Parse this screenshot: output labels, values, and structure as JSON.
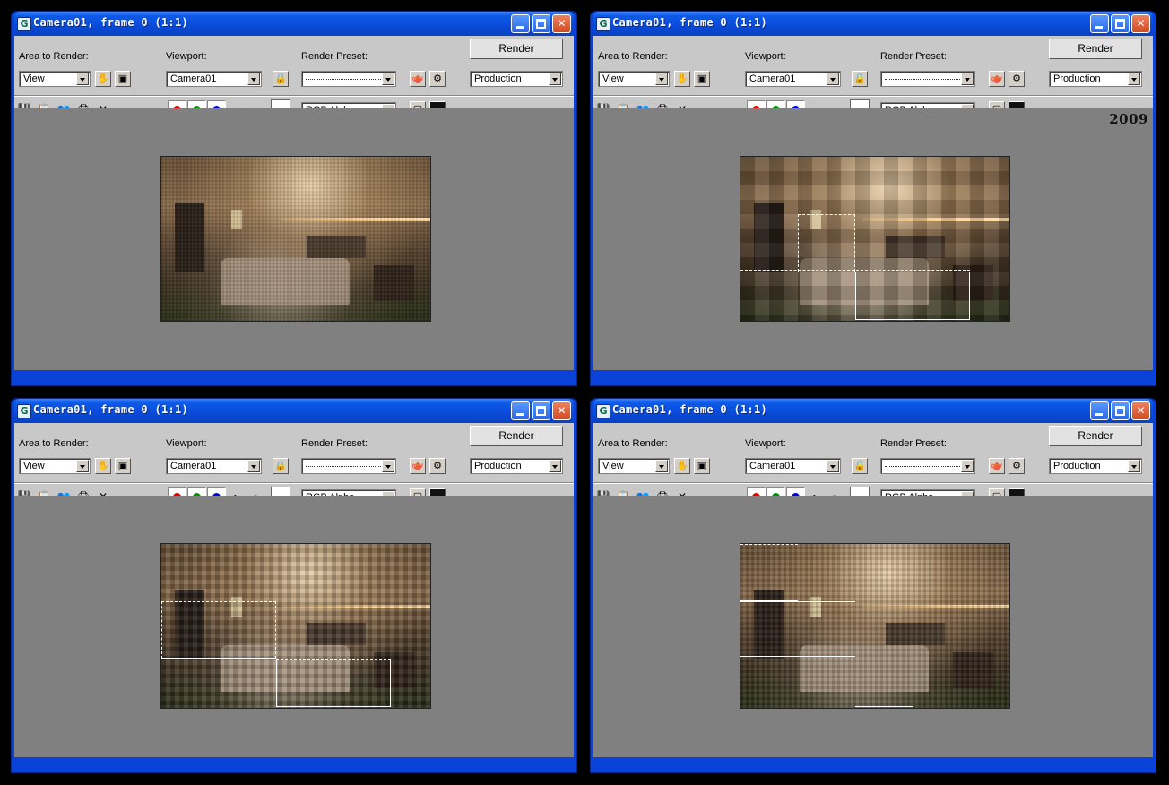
{
  "windows": [
    {
      "title": "Camera01, frame 0 (1:1)",
      "area_to_render_label": "Area to Render:",
      "area_to_render_value": "View",
      "viewport_label": "Viewport:",
      "viewport_value": "Camera01",
      "render_preset_label": "Render Preset:",
      "render_button": "Render",
      "preset_value": "Production",
      "channel_value": "RGB Alpha",
      "year": ""
    },
    {
      "title": "Camera01, frame 0 (1:1)",
      "area_to_render_label": "Area to Render:",
      "area_to_render_value": "View",
      "viewport_label": "Viewport:",
      "viewport_value": "Camera01",
      "render_preset_label": "Render Preset:",
      "render_button": "Render",
      "preset_value": "Production",
      "channel_value": "RGB Alpha",
      "year": "2009"
    },
    {
      "title": "Camera01, frame 0 (1:1)",
      "area_to_render_label": "Area to Render:",
      "area_to_render_value": "View",
      "viewport_label": "Viewport:",
      "viewport_value": "Camera01",
      "render_preset_label": "Render Preset:",
      "render_button": "Render",
      "preset_value": "Production",
      "channel_value": "RGB Alpha",
      "year": ""
    },
    {
      "title": "Camera01, frame 0 (1:1)",
      "area_to_render_label": "Area to Render:",
      "area_to_render_value": "View",
      "viewport_label": "Viewport:",
      "viewport_value": "Camera01",
      "render_preset_label": "Render Preset:",
      "render_button": "Render",
      "preset_value": "Production",
      "channel_value": "RGB Alpha",
      "year": ""
    }
  ],
  "icons": {
    "app": "3dsmax-icon",
    "minimize": "minimize-icon",
    "maximize": "maximize-icon",
    "close": "close-icon",
    "save": "save-icon",
    "copy": "copy-icon",
    "clone": "clone-window-icon",
    "print": "print-icon",
    "clear": "clear-icon",
    "red": "red-channel-icon",
    "green": "green-channel-icon",
    "blue": "blue-channel-icon",
    "mono": "monochrome-icon",
    "alpha": "alpha-channel-icon"
  },
  "colors": {
    "titlebar": "#0a4ad8",
    "panel": "#c8c8c8",
    "render_area": "#808080",
    "red_channel": "#e00000",
    "green_channel": "#009000",
    "blue_channel": "#0000d0"
  }
}
